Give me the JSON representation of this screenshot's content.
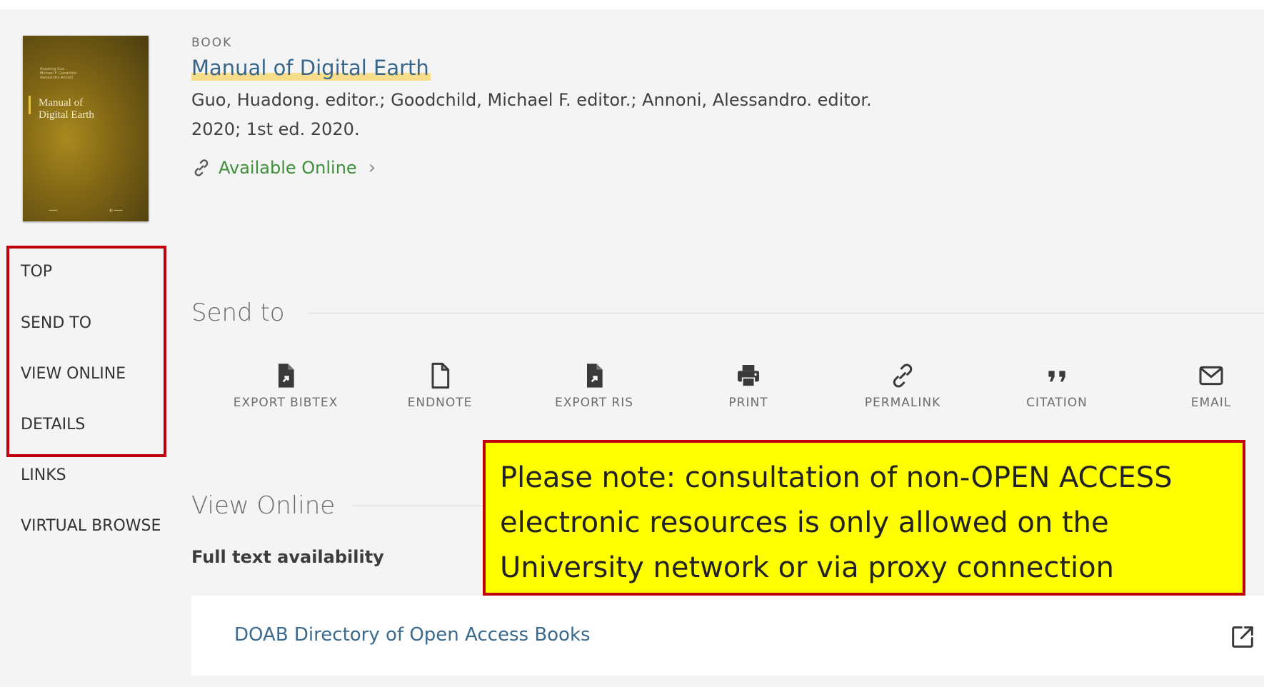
{
  "record": {
    "type": "BOOK",
    "title": "Manual of Digital Earth",
    "authors": "Guo, Huadong. editor.; Goodchild, Michael F. editor.; Annoni, Alessandro. editor.",
    "edition": "2020; 1st ed. 2020.",
    "availability": "Available Online",
    "cover": {
      "title_line1": "Manual of",
      "title_line2": "Digital Earth",
      "small_lines": [
        "Huadong Guo",
        "Michael F. Goodchild",
        "Alessandro Annoni"
      ]
    }
  },
  "nav": {
    "items": [
      "TOP",
      "SEND TO",
      "VIEW ONLINE",
      "DETAILS",
      "LINKS",
      "VIRTUAL BROWSE"
    ]
  },
  "send_to": {
    "title": "Send to",
    "actions": [
      {
        "label": "EXPORT BIBTEX",
        "icon": "export-bibtex-icon"
      },
      {
        "label": "ENDNOTE",
        "icon": "endnote-icon"
      },
      {
        "label": "EXPORT RIS",
        "icon": "export-ris-icon"
      },
      {
        "label": "PRINT",
        "icon": "print-icon"
      },
      {
        "label": "PERMALINK",
        "icon": "permalink-icon"
      },
      {
        "label": "CITATION",
        "icon": "citation-icon"
      },
      {
        "label": "EMAIL",
        "icon": "email-icon"
      }
    ]
  },
  "view_online": {
    "title": "View Online",
    "subtitle": "Full text availability",
    "resource": "DOAB Directory of Open Access Books"
  },
  "note": {
    "line1": "Please note: consultation of non-OPEN ACCESS",
    "line2": "electronic resources is only allowed on the",
    "line3": "University network or via proxy connection"
  },
  "colors": {
    "title_link": "#38668a",
    "available": "#3e8f3a",
    "highlight_border": "#c0000a",
    "note_background": "#ffff00"
  }
}
